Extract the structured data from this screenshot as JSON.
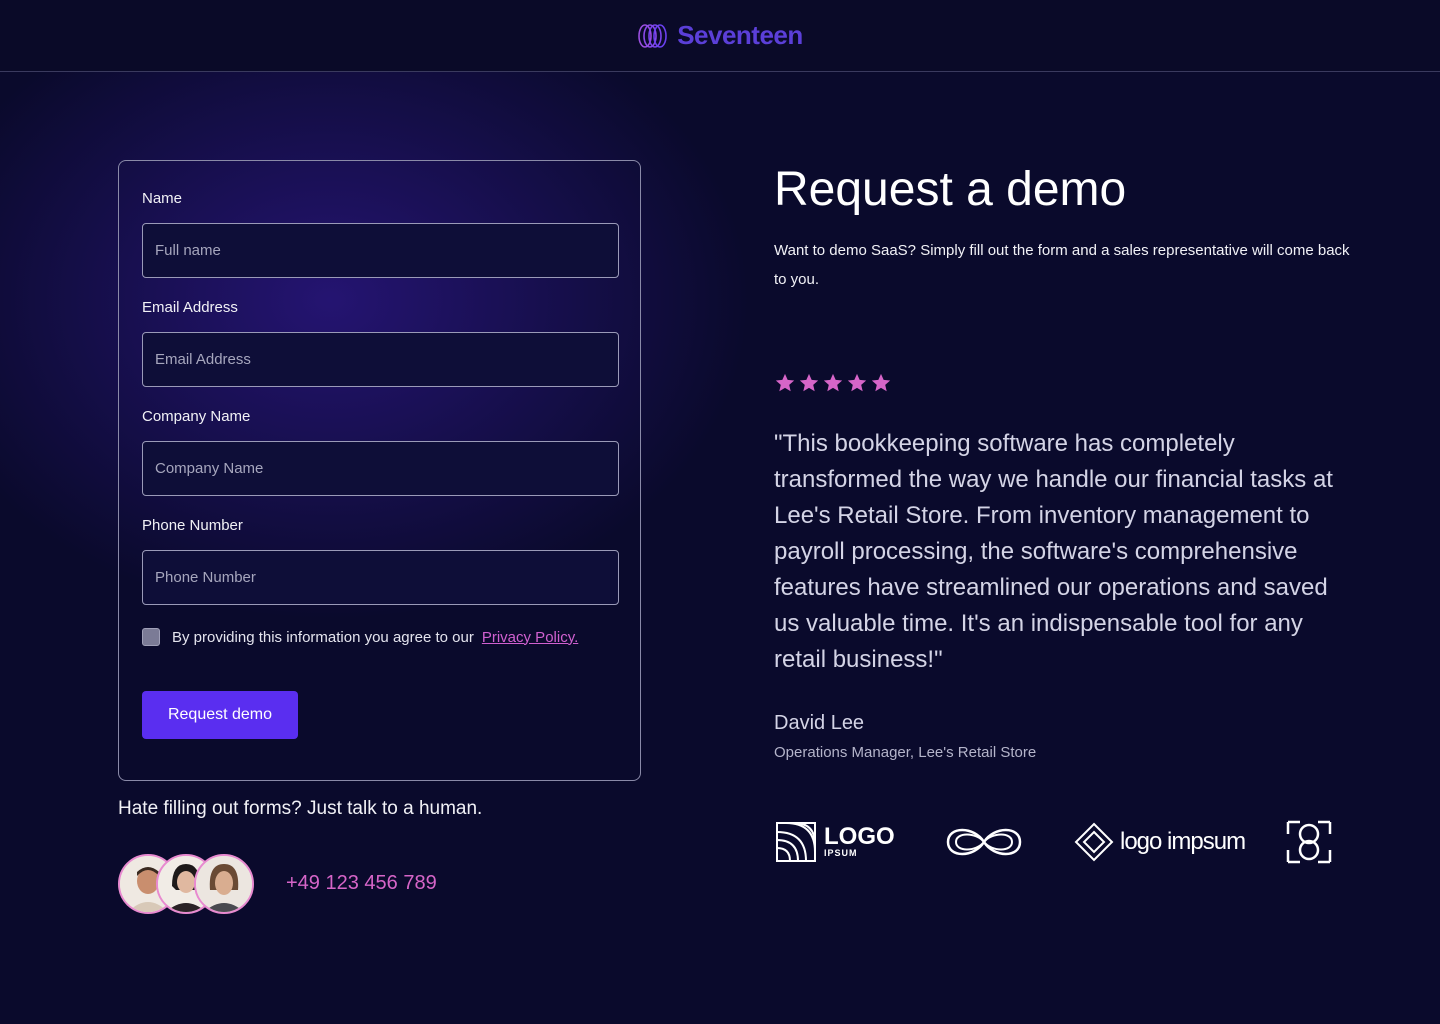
{
  "header": {
    "brand_name": "Seventeen",
    "logo_icon": "concentric-rings-logo-icon"
  },
  "form": {
    "fields": [
      {
        "label": "Name",
        "placeholder": "Full name",
        "value": ""
      },
      {
        "label": "Email Address",
        "placeholder": "Email Address",
        "value": ""
      },
      {
        "label": "Company Name",
        "placeholder": "Company Name",
        "value": ""
      },
      {
        "label": "Phone Number",
        "placeholder": "Phone Number",
        "value": ""
      }
    ],
    "consent_text": "By providing this information you agree to our",
    "privacy_link": "Privacy Policy.",
    "consent_checked": false,
    "submit_label": "Request demo"
  },
  "contact": {
    "talk_text": "Hate filling out forms? Just talk to a human.",
    "phone": "+49 123 456 789"
  },
  "hero": {
    "title": "Request a demo",
    "subtitle": "Want to demo SaaS? Simply fill out the form and a sales representative will come back to you."
  },
  "testimonial": {
    "rating": 5,
    "quote": "\"This bookkeeping software has completely transformed the way we handle our financial tasks at Lee's Retail Store. From inventory management to payroll processing, the software's comprehensive features have streamlined our operations and saved us valuable time. It's an indispensable tool for any retail business!\"",
    "author": "David Lee",
    "role": "Operations Manager, Lee's Retail Store"
  },
  "logos": {
    "logo1_word": "LOGO",
    "logo1_sub": "IPSUM",
    "logo3_text": "logo impsum"
  },
  "colors": {
    "background": "#0a0a2c",
    "accent": "#5a2ef0",
    "brand": "#5b3fd8",
    "star": "#d665c8",
    "link": "#d060d0"
  }
}
